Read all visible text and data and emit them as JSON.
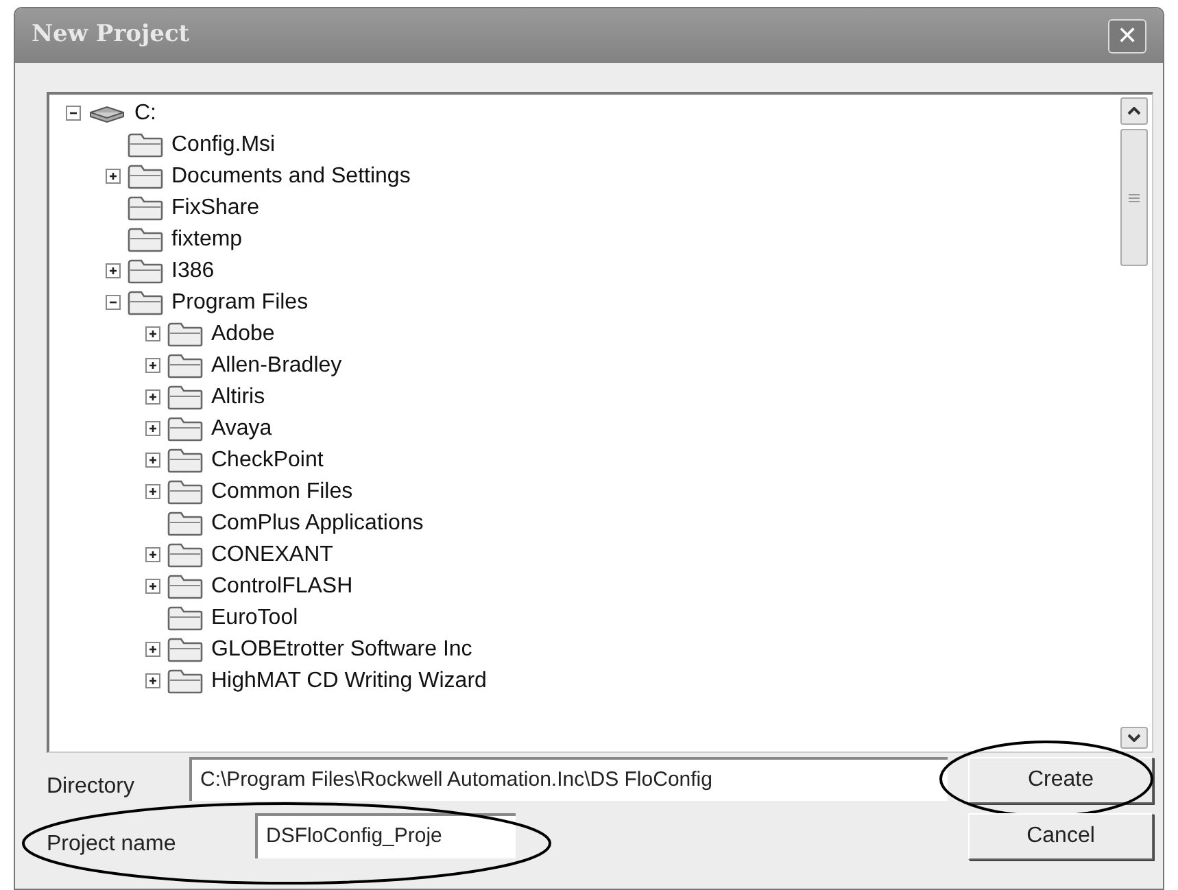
{
  "window": {
    "title": "New Project",
    "close": "✕"
  },
  "tree": [
    {
      "label": "C:",
      "kind": "drive",
      "expanded": true,
      "children": [
        {
          "label": "Config.Msi",
          "kind": "folder"
        },
        {
          "label": "Documents and Settings",
          "kind": "folder",
          "expanded": false
        },
        {
          "label": "FixShare",
          "kind": "folder"
        },
        {
          "label": "fixtemp",
          "kind": "folder"
        },
        {
          "label": "I386",
          "kind": "folder",
          "expanded": false
        },
        {
          "label": "Program Files",
          "kind": "folder",
          "expanded": true,
          "children": [
            {
              "label": "Adobe",
              "kind": "folder",
              "expanded": false
            },
            {
              "label": "Allen-Bradley",
              "kind": "folder",
              "expanded": false
            },
            {
              "label": "Altiris",
              "kind": "folder",
              "expanded": false
            },
            {
              "label": "Avaya",
              "kind": "folder",
              "expanded": false
            },
            {
              "label": "CheckPoint",
              "kind": "folder",
              "expanded": false
            },
            {
              "label": "Common Files",
              "kind": "folder",
              "expanded": false
            },
            {
              "label": "ComPlus Applications",
              "kind": "folder"
            },
            {
              "label": "CONEXANT",
              "kind": "folder",
              "expanded": false
            },
            {
              "label": "ControlFLASH",
              "kind": "folder",
              "expanded": false
            },
            {
              "label": "EuroTool",
              "kind": "folder"
            },
            {
              "label": "GLOBEtrotter Software Inc",
              "kind": "folder",
              "expanded": false
            },
            {
              "label": "HighMAT CD Writing Wizard",
              "kind": "folder",
              "expanded": false
            }
          ]
        }
      ]
    }
  ],
  "directory": {
    "label": "Directory",
    "value": "C:\\Program Files\\Rockwell Automation.Inc\\DS FloConfig"
  },
  "project_name": {
    "label": "Project name",
    "value": "DSFloConfig_Proje"
  },
  "buttons": [
    {
      "label": "Create",
      "circled": true
    },
    {
      "label": "Cancel",
      "circled": false
    }
  ],
  "project_name_circled": true
}
